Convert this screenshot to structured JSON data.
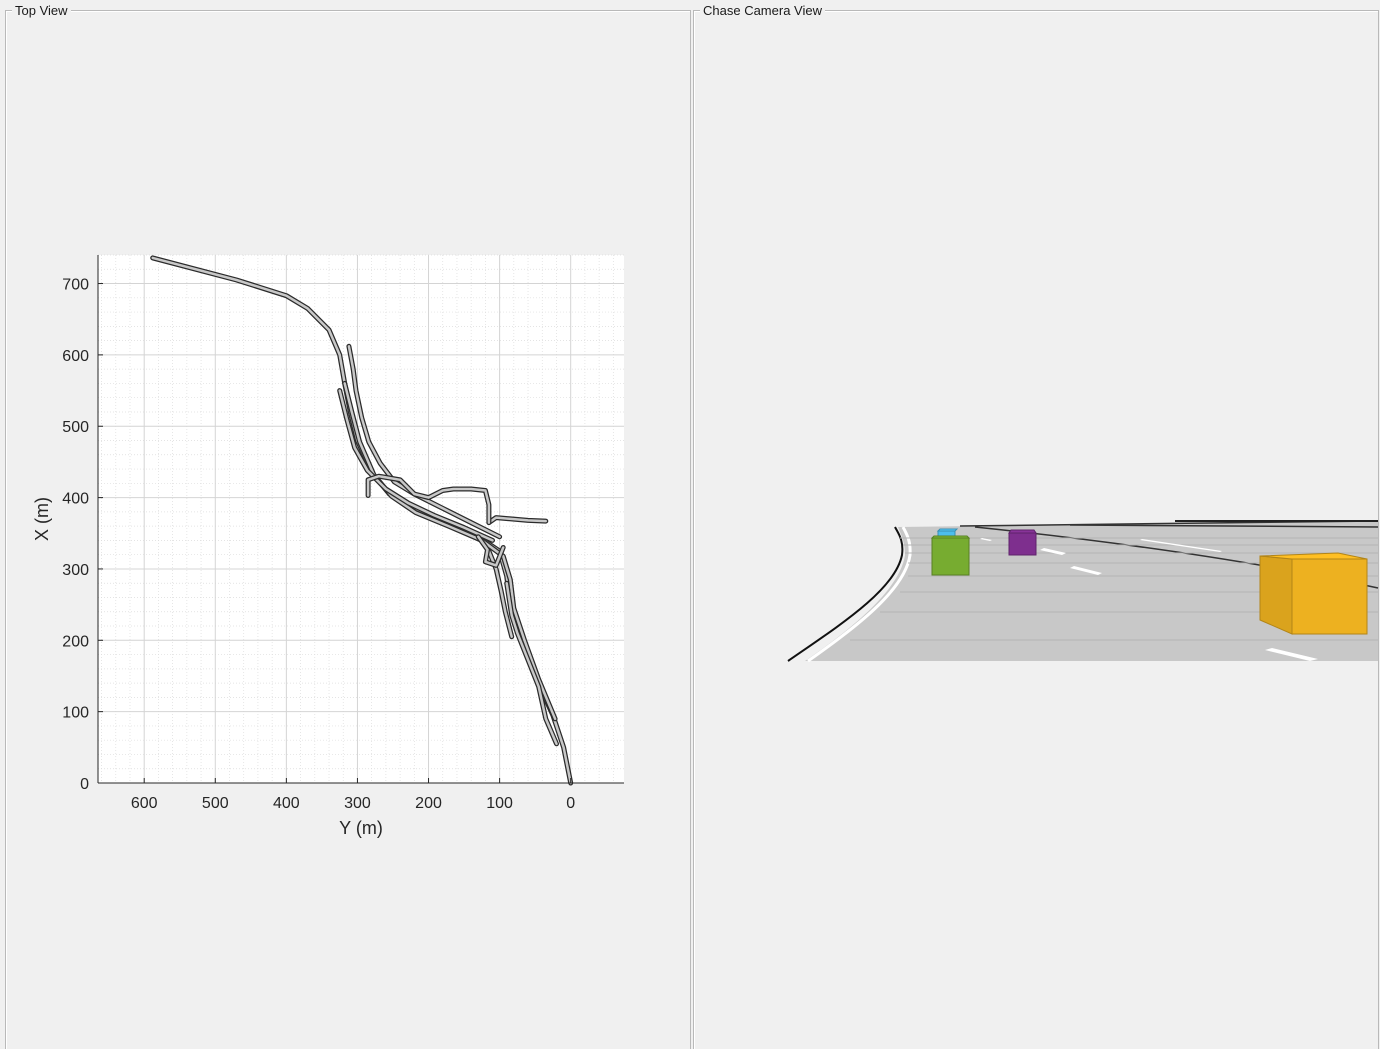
{
  "panels": {
    "top_view": {
      "title": "Top View"
    },
    "chase_view": {
      "title": "Chase Camera View"
    }
  },
  "chart_data": {
    "type": "line",
    "title": "",
    "xlabel": "Y (m)",
    "ylabel": "X (m)",
    "xlim": [
      -75,
      665
    ],
    "ylim": [
      0,
      740
    ],
    "x_reversed": true,
    "grid": "on",
    "minor_grid": "on",
    "xticks": [
      600,
      500,
      400,
      300,
      200,
      100,
      0
    ],
    "yticks": [
      0,
      100,
      200,
      300,
      400,
      500,
      600,
      700
    ],
    "series": [
      {
        "points": [
          [
            588,
            736
          ],
          [
            470,
            705
          ],
          [
            400,
            683
          ],
          [
            370,
            665
          ],
          [
            340,
            635
          ],
          [
            325,
            600
          ],
          [
            318,
            560
          ],
          [
            310,
            520
          ],
          [
            300,
            480
          ],
          [
            280,
            435
          ],
          [
            255,
            405
          ],
          [
            220,
            383
          ],
          [
            175,
            365
          ],
          [
            130,
            345
          ],
          [
            100,
            325
          ],
          [
            90,
            290
          ],
          [
            85,
            250
          ],
          [
            70,
            205
          ],
          [
            50,
            150
          ],
          [
            25,
            95
          ],
          [
            10,
            50
          ],
          [
            0,
            0
          ]
        ]
      },
      {
        "points": [
          [
            318,
            560
          ],
          [
            308,
            520
          ],
          [
            297,
            478
          ],
          [
            277,
            432
          ],
          [
            252,
            402
          ],
          [
            218,
            379
          ],
          [
            172,
            360
          ],
          [
            125,
            340
          ],
          [
            95,
            318
          ],
          [
            85,
            285
          ],
          [
            80,
            245
          ],
          [
            65,
            200
          ],
          [
            45,
            145
          ],
          [
            22,
            90
          ]
        ]
      },
      {
        "points": [
          [
            312,
            612
          ],
          [
            306,
            580
          ],
          [
            302,
            550
          ],
          [
            294,
            512
          ],
          [
            284,
            478
          ],
          [
            268,
            448
          ],
          [
            248,
            422
          ],
          [
            220,
            405
          ],
          [
            180,
            385
          ],
          [
            140,
            365
          ],
          [
            100,
            345
          ]
        ]
      },
      {
        "points": [
          [
            325,
            550
          ],
          [
            315,
            510
          ],
          [
            304,
            470
          ],
          [
            286,
            438
          ],
          [
            260,
            412
          ],
          [
            228,
            392
          ],
          [
            192,
            375
          ],
          [
            150,
            358
          ],
          [
            110,
            340
          ]
        ]
      },
      {
        "points": [
          [
            90,
            280
          ],
          [
            83,
            235
          ],
          [
            75,
            210
          ],
          [
            57,
            165
          ],
          [
            45,
            135
          ],
          [
            35,
            90
          ],
          [
            20,
            55
          ]
        ]
      },
      {
        "points": [
          [
            115,
            325
          ],
          [
            105,
            300
          ],
          [
            98,
            270
          ],
          [
            92,
            240
          ],
          [
            83,
            205
          ]
        ]
      },
      {
        "points": [
          [
            130,
            345
          ],
          [
            117,
            327
          ],
          [
            120,
            310
          ],
          [
            105,
            305
          ],
          [
            95,
            330
          ]
        ]
      },
      {
        "points": [
          [
            115,
            365
          ],
          [
            105,
            372
          ],
          [
            60,
            368
          ],
          [
            35,
            367
          ]
        ]
      },
      {
        "points": [
          [
            115,
            365
          ],
          [
            115,
            390
          ],
          [
            120,
            410
          ],
          [
            140,
            412
          ],
          [
            165,
            412
          ],
          [
            180,
            410
          ],
          [
            200,
            400
          ],
          [
            220,
            405
          ],
          [
            240,
            425
          ],
          [
            270,
            430
          ],
          [
            285,
            425
          ],
          [
            285,
            403
          ]
        ]
      }
    ]
  },
  "scene": {
    "road_color": "#c8c8c8",
    "actors": [
      {
        "name": "yellow-vehicle",
        "color": "#edb120"
      },
      {
        "name": "green-vehicle",
        "color": "#77ac30"
      },
      {
        "name": "purple-vehicle",
        "color": "#7e2f8e"
      },
      {
        "name": "cyan-vehicle",
        "color": "#4dbeee"
      }
    ]
  }
}
